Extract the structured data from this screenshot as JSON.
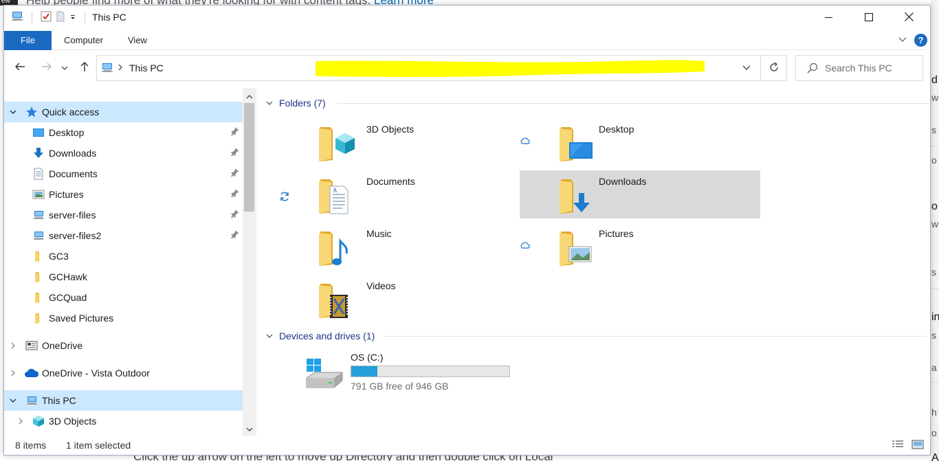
{
  "background": {
    "top_text": "Help people find more of what they're looking for with content tags.",
    "top_link": "Learn more",
    "top_tag": "ew",
    "bottom_text": "Click the up arrow on the left to move up Directory and then double click on Local",
    "right_fragments": [
      "d",
      "w",
      "s",
      "o",
      "o",
      "w",
      "s",
      "in",
      "s",
      "a",
      "h",
      "o",
      "A"
    ]
  },
  "window": {
    "title": "This PC",
    "controls": {
      "minimize": "minimize",
      "maximize": "maximize",
      "close": "close"
    }
  },
  "ribbon": {
    "tabs": [
      {
        "label": "File"
      },
      {
        "label": "Computer"
      },
      {
        "label": "View"
      }
    ],
    "help": "?"
  },
  "address_bar": {
    "location_icon": "this-pc-icon",
    "breadcrumb": "This PC",
    "redaction_color": "#ffff00"
  },
  "search": {
    "placeholder": "Search This PC"
  },
  "nav_pane": {
    "items": [
      {
        "label": "Quick access",
        "icon": "star-icon",
        "expanded": true,
        "selected": true
      },
      {
        "label": "Desktop",
        "icon": "desktop-folder-icon",
        "pinned": true
      },
      {
        "label": "Downloads",
        "icon": "downloads-icon",
        "pinned": true
      },
      {
        "label": "Documents",
        "icon": "documents-icon",
        "pinned": true
      },
      {
        "label": "Pictures",
        "icon": "pictures-icon",
        "pinned": true
      },
      {
        "label": "server-files",
        "icon": "network-drive-icon",
        "pinned": true
      },
      {
        "label": "server-files2",
        "icon": "network-drive-icon",
        "pinned": true
      },
      {
        "label": "GC3",
        "icon": "folder-icon"
      },
      {
        "label": "GCHawk",
        "icon": "folder-icon"
      },
      {
        "label": "GCQuad",
        "icon": "folder-icon"
      },
      {
        "label": "Saved Pictures",
        "icon": "folder-icon"
      },
      {
        "label": "OneDrive",
        "icon": "onedrive-icon"
      },
      {
        "label": "OneDrive - Vista Outdoor",
        "icon": "cloud-icon"
      },
      {
        "label": "This PC",
        "icon": "this-pc-icon",
        "expanded": true,
        "selected": true
      },
      {
        "label": "3D Objects",
        "icon": "3d-objects-icon"
      }
    ]
  },
  "content": {
    "folders_header": "Folders (7)",
    "folders": [
      {
        "label": "3D Objects",
        "icon": "3d-objects-folder-icon",
        "status": ""
      },
      {
        "label": "Desktop",
        "icon": "desktop-folder-icon",
        "status": "cloud-icon"
      },
      {
        "label": "Documents",
        "icon": "documents-folder-icon",
        "status": "sync-icon"
      },
      {
        "label": "Downloads",
        "icon": "downloads-folder-icon",
        "status": "",
        "selected": true
      },
      {
        "label": "Music",
        "icon": "music-folder-icon",
        "status": ""
      },
      {
        "label": "Pictures",
        "icon": "pictures-folder-icon",
        "status": "cloud-icon"
      },
      {
        "label": "Videos",
        "icon": "videos-folder-icon",
        "status": ""
      }
    ],
    "drives_header": "Devices and drives (1)",
    "drives": [
      {
        "label": "OS (C:)",
        "free_text": "791 GB free of 946 GB",
        "used_fraction": 0.164,
        "icon": "windows-drive-icon"
      }
    ]
  },
  "status_bar": {
    "item_count": "8 items",
    "selection": "1 item selected",
    "views": [
      "details-view-icon",
      "large-icons-view-icon"
    ]
  },
  "colors": {
    "accent": "#1a6ac2",
    "selection": "#cce8ff",
    "tile_selected": "#d9d9d9",
    "header_text": "#1e3287",
    "drive_fill": "#26a0da"
  }
}
